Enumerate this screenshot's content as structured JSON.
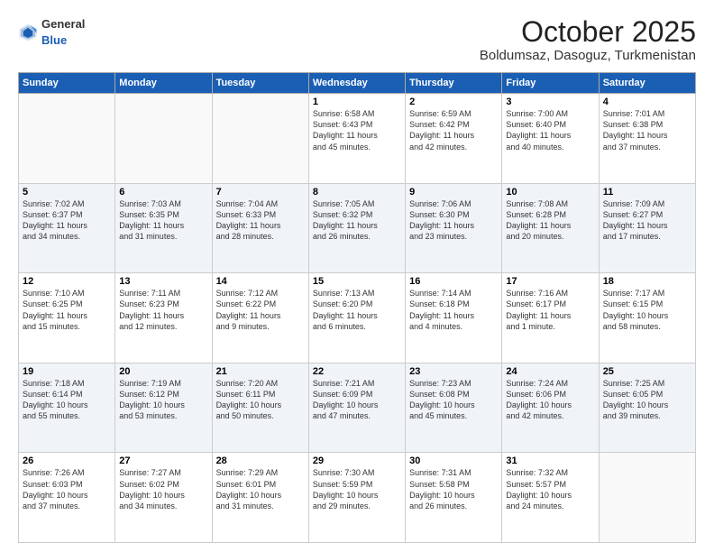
{
  "header": {
    "logo_general": "General",
    "logo_blue": "Blue",
    "month": "October 2025",
    "location": "Boldumsaz, Dasoguz, Turkmenistan"
  },
  "days_of_week": [
    "Sunday",
    "Monday",
    "Tuesday",
    "Wednesday",
    "Thursday",
    "Friday",
    "Saturday"
  ],
  "weeks": [
    [
      {
        "day": "",
        "info": ""
      },
      {
        "day": "",
        "info": ""
      },
      {
        "day": "",
        "info": ""
      },
      {
        "day": "1",
        "info": "Sunrise: 6:58 AM\nSunset: 6:43 PM\nDaylight: 11 hours\nand 45 minutes."
      },
      {
        "day": "2",
        "info": "Sunrise: 6:59 AM\nSunset: 6:42 PM\nDaylight: 11 hours\nand 42 minutes."
      },
      {
        "day": "3",
        "info": "Sunrise: 7:00 AM\nSunset: 6:40 PM\nDaylight: 11 hours\nand 40 minutes."
      },
      {
        "day": "4",
        "info": "Sunrise: 7:01 AM\nSunset: 6:38 PM\nDaylight: 11 hours\nand 37 minutes."
      }
    ],
    [
      {
        "day": "5",
        "info": "Sunrise: 7:02 AM\nSunset: 6:37 PM\nDaylight: 11 hours\nand 34 minutes."
      },
      {
        "day": "6",
        "info": "Sunrise: 7:03 AM\nSunset: 6:35 PM\nDaylight: 11 hours\nand 31 minutes."
      },
      {
        "day": "7",
        "info": "Sunrise: 7:04 AM\nSunset: 6:33 PM\nDaylight: 11 hours\nand 28 minutes."
      },
      {
        "day": "8",
        "info": "Sunrise: 7:05 AM\nSunset: 6:32 PM\nDaylight: 11 hours\nand 26 minutes."
      },
      {
        "day": "9",
        "info": "Sunrise: 7:06 AM\nSunset: 6:30 PM\nDaylight: 11 hours\nand 23 minutes."
      },
      {
        "day": "10",
        "info": "Sunrise: 7:08 AM\nSunset: 6:28 PM\nDaylight: 11 hours\nand 20 minutes."
      },
      {
        "day": "11",
        "info": "Sunrise: 7:09 AM\nSunset: 6:27 PM\nDaylight: 11 hours\nand 17 minutes."
      }
    ],
    [
      {
        "day": "12",
        "info": "Sunrise: 7:10 AM\nSunset: 6:25 PM\nDaylight: 11 hours\nand 15 minutes."
      },
      {
        "day": "13",
        "info": "Sunrise: 7:11 AM\nSunset: 6:23 PM\nDaylight: 11 hours\nand 12 minutes."
      },
      {
        "day": "14",
        "info": "Sunrise: 7:12 AM\nSunset: 6:22 PM\nDaylight: 11 hours\nand 9 minutes."
      },
      {
        "day": "15",
        "info": "Sunrise: 7:13 AM\nSunset: 6:20 PM\nDaylight: 11 hours\nand 6 minutes."
      },
      {
        "day": "16",
        "info": "Sunrise: 7:14 AM\nSunset: 6:18 PM\nDaylight: 11 hours\nand 4 minutes."
      },
      {
        "day": "17",
        "info": "Sunrise: 7:16 AM\nSunset: 6:17 PM\nDaylight: 11 hours\nand 1 minute."
      },
      {
        "day": "18",
        "info": "Sunrise: 7:17 AM\nSunset: 6:15 PM\nDaylight: 10 hours\nand 58 minutes."
      }
    ],
    [
      {
        "day": "19",
        "info": "Sunrise: 7:18 AM\nSunset: 6:14 PM\nDaylight: 10 hours\nand 55 minutes."
      },
      {
        "day": "20",
        "info": "Sunrise: 7:19 AM\nSunset: 6:12 PM\nDaylight: 10 hours\nand 53 minutes."
      },
      {
        "day": "21",
        "info": "Sunrise: 7:20 AM\nSunset: 6:11 PM\nDaylight: 10 hours\nand 50 minutes."
      },
      {
        "day": "22",
        "info": "Sunrise: 7:21 AM\nSunset: 6:09 PM\nDaylight: 10 hours\nand 47 minutes."
      },
      {
        "day": "23",
        "info": "Sunrise: 7:23 AM\nSunset: 6:08 PM\nDaylight: 10 hours\nand 45 minutes."
      },
      {
        "day": "24",
        "info": "Sunrise: 7:24 AM\nSunset: 6:06 PM\nDaylight: 10 hours\nand 42 minutes."
      },
      {
        "day": "25",
        "info": "Sunrise: 7:25 AM\nSunset: 6:05 PM\nDaylight: 10 hours\nand 39 minutes."
      }
    ],
    [
      {
        "day": "26",
        "info": "Sunrise: 7:26 AM\nSunset: 6:03 PM\nDaylight: 10 hours\nand 37 minutes."
      },
      {
        "day": "27",
        "info": "Sunrise: 7:27 AM\nSunset: 6:02 PM\nDaylight: 10 hours\nand 34 minutes."
      },
      {
        "day": "28",
        "info": "Sunrise: 7:29 AM\nSunset: 6:01 PM\nDaylight: 10 hours\nand 31 minutes."
      },
      {
        "day": "29",
        "info": "Sunrise: 7:30 AM\nSunset: 5:59 PM\nDaylight: 10 hours\nand 29 minutes."
      },
      {
        "day": "30",
        "info": "Sunrise: 7:31 AM\nSunset: 5:58 PM\nDaylight: 10 hours\nand 26 minutes."
      },
      {
        "day": "31",
        "info": "Sunrise: 7:32 AM\nSunset: 5:57 PM\nDaylight: 10 hours\nand 24 minutes."
      },
      {
        "day": "",
        "info": ""
      }
    ]
  ]
}
